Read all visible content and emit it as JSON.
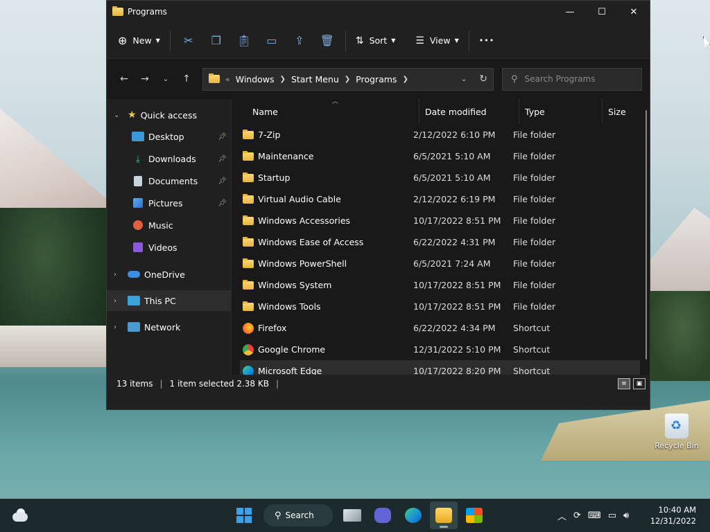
{
  "window": {
    "title": "Programs",
    "controls": {
      "minimize": "—",
      "maximize": "☐",
      "close": "✕"
    }
  },
  "toolbar": {
    "new_label": "New",
    "sort_label": "Sort",
    "view_label": "View",
    "more_label": "•••"
  },
  "address": {
    "overflow": "«",
    "crumbs": [
      "Windows",
      "Start Menu",
      "Programs"
    ]
  },
  "search": {
    "placeholder": "Search Programs"
  },
  "nav": {
    "quick_access": "Quick access",
    "quick_items": [
      {
        "label": "Desktop",
        "icon": "desktop-icon",
        "color": "#3a9ad9"
      },
      {
        "label": "Downloads",
        "icon": "download-icon",
        "color": "#2fbf8f"
      },
      {
        "label": "Documents",
        "icon": "document-icon",
        "color": "#c9d3dc"
      },
      {
        "label": "Pictures",
        "icon": "pictures-icon",
        "color": "#3b82d6"
      },
      {
        "label": "Music",
        "icon": "music-icon",
        "color": "#e06040"
      },
      {
        "label": "Videos",
        "icon": "video-icon",
        "color": "#8a5ad8"
      }
    ],
    "onedrive": "OneDrive",
    "this_pc": "This PC",
    "network": "Network"
  },
  "columns": {
    "name": "Name",
    "date": "Date modified",
    "type": "Type",
    "size": "Size"
  },
  "files": [
    {
      "name": "7-Zip",
      "date": "2/12/2022 6:10 PM",
      "type": "File folder",
      "icon": "folder-icon"
    },
    {
      "name": "Maintenance",
      "date": "6/5/2021 5:10 AM",
      "type": "File folder",
      "icon": "folder-icon"
    },
    {
      "name": "Startup",
      "date": "6/5/2021 5:10 AM",
      "type": "File folder",
      "icon": "folder-icon"
    },
    {
      "name": "Virtual Audio Cable",
      "date": "2/12/2022 6:19 PM",
      "type": "File folder",
      "icon": "folder-icon"
    },
    {
      "name": "Windows Accessories",
      "date": "10/17/2022 8:51 PM",
      "type": "File folder",
      "icon": "folder-icon"
    },
    {
      "name": "Windows Ease of Access",
      "date": "6/22/2022 4:31 PM",
      "type": "File folder",
      "icon": "folder-icon"
    },
    {
      "name": "Windows PowerShell",
      "date": "6/5/2021 7:24 AM",
      "type": "File folder",
      "icon": "folder-icon"
    },
    {
      "name": "Windows System",
      "date": "10/17/2022 8:51 PM",
      "type": "File folder",
      "icon": "folder-icon"
    },
    {
      "name": "Windows Tools",
      "date": "10/17/2022 8:51 PM",
      "type": "File folder",
      "icon": "folder-icon"
    },
    {
      "name": "Firefox",
      "date": "6/22/2022 4:34 PM",
      "type": "Shortcut",
      "icon": "firefox-icon"
    },
    {
      "name": "Google Chrome",
      "date": "12/31/2022 5:10 PM",
      "type": "Shortcut",
      "icon": "chrome-icon"
    },
    {
      "name": "Microsoft Edge",
      "date": "10/17/2022 8:20 PM",
      "type": "Shortcut",
      "icon": "edge-icon"
    }
  ],
  "status": {
    "count": "13 items",
    "selection": "1 item selected  2.38 KB"
  },
  "desktop": {
    "recycle_bin": "Recycle Bin"
  },
  "taskbar": {
    "search_label": "Search",
    "time": "10:40 AM",
    "date": "12/31/2022"
  }
}
